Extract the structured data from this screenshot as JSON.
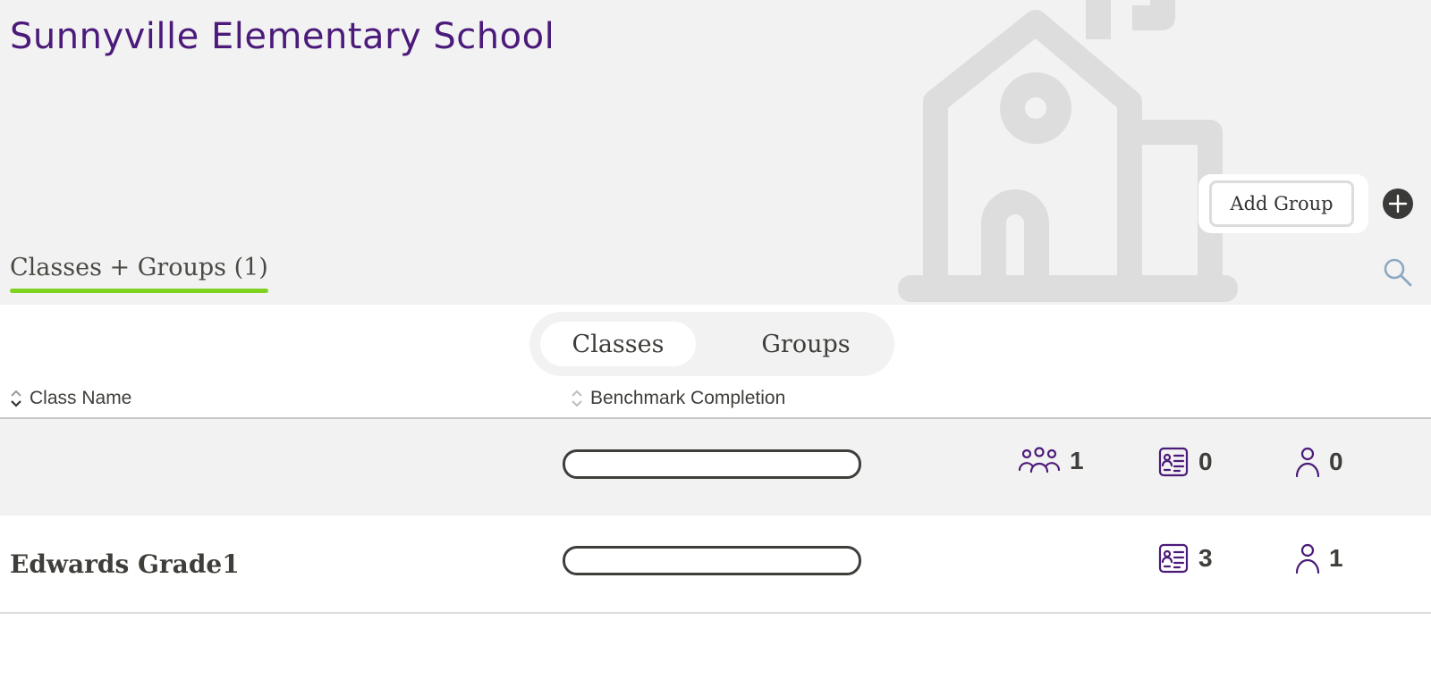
{
  "colors": {
    "title": "#4b1a7a",
    "accent_green": "#7ed321",
    "icon_purple": "#4b1a7a",
    "text_dark": "#3e3e3a"
  },
  "header": {
    "school_name": "Sunnyville Elementary School",
    "add_group_label": "Add Group",
    "add_icon": "plus-circle-icon",
    "search_icon": "search-icon"
  },
  "section": {
    "tab_label": "Classes + Groups (1)"
  },
  "toggle": {
    "items": [
      {
        "label": "Classes",
        "active": true
      },
      {
        "label": "Groups",
        "active": false
      }
    ]
  },
  "table": {
    "columns": [
      {
        "label": "Class Name"
      },
      {
        "label": "Benchmark Completion"
      }
    ],
    "rows": [
      {
        "name": "",
        "benchmark_completion": 0,
        "groups": "1",
        "assessments": "0",
        "students": "0"
      },
      {
        "name": "Edwards Grade1",
        "benchmark_completion": 0,
        "assessments": "3",
        "students": "1"
      }
    ]
  }
}
